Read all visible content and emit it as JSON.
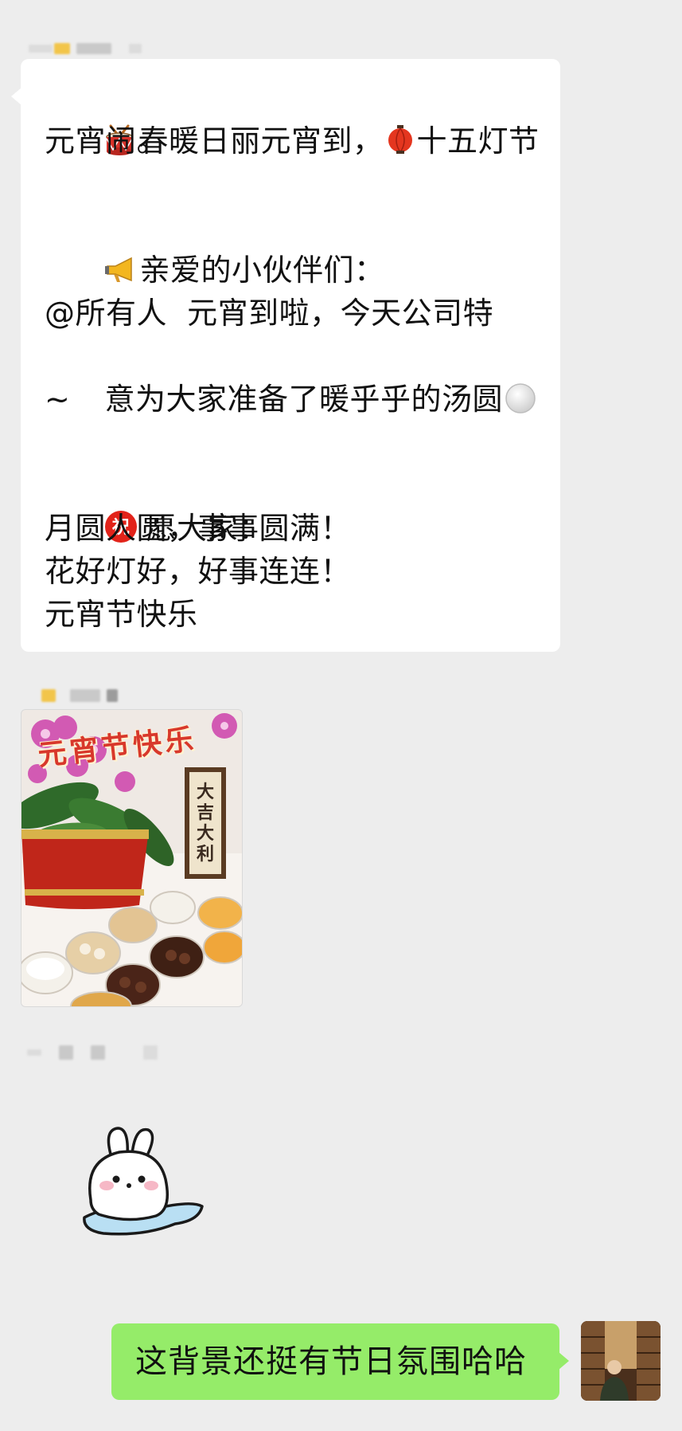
{
  "messages": {
    "incoming_text": {
      "line1_prefix_emoji": "drum-icon",
      "line1_a": "春暖日丽元宵到，",
      "line1_lantern_emoji": "lantern-icon",
      "line1_b": "十五灯节",
      "line2": "元宵闹。",
      "line3_emoji": "megaphone-icon",
      "line3": "亲爱的小伙伴们：",
      "line4": "@所有人  元宵到啦，今天公司特",
      "line5": "意为大家准备了暖乎乎的汤圆",
      "line5_emoji": "white-circle-icon",
      "line6": "~",
      "line7_badge": "祝",
      "line7": "愿大家：",
      "line8": "月圆人圆，事事圆满！",
      "line9": "花好灯好，好事连连！",
      "line10": "元宵节快乐"
    },
    "image_message": {
      "title_text": "元宵节快乐",
      "plaque_text": "大吉大利",
      "image_desc": "orchid-and-tangyuan-image"
    },
    "sticker": {
      "name": "bunny-sticker"
    },
    "outgoing_text": {
      "text": "这背景还挺有节日氛围哈哈"
    }
  },
  "colors": {
    "background": "#ededed",
    "incoming_bubble": "#ffffff",
    "outgoing_bubble": "#95ec69",
    "badge_red": "#e2231a"
  }
}
